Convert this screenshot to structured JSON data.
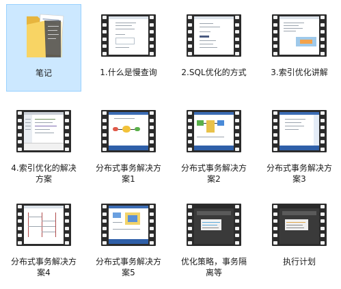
{
  "items": [
    {
      "label": "笔记",
      "type": "folder",
      "selected": true
    },
    {
      "label": "1.什么是慢查询",
      "type": "video",
      "style": "doc"
    },
    {
      "label": "2.SQL优化的方式",
      "type": "video",
      "style": "doc"
    },
    {
      "label": "3.索引优化讲解",
      "type": "video",
      "style": "doc2"
    },
    {
      "label": "4.索引优化的解决方案",
      "type": "video",
      "style": "ide"
    },
    {
      "label": "分布式事务解决方案1",
      "type": "video",
      "style": "slide"
    },
    {
      "label": "分布式事务解决方案2",
      "type": "video",
      "style": "slide"
    },
    {
      "label": "分布式事务解决方案3",
      "type": "video",
      "style": "slide2"
    },
    {
      "label": "分布式事务解决方案4",
      "type": "video",
      "style": "diagram"
    },
    {
      "label": "分布式事务解决方案5",
      "type": "video",
      "style": "slide"
    },
    {
      "label": "优化策略，事务隔离等",
      "type": "video",
      "style": "dark"
    },
    {
      "label": "执行计划",
      "type": "video",
      "style": "dark"
    }
  ]
}
